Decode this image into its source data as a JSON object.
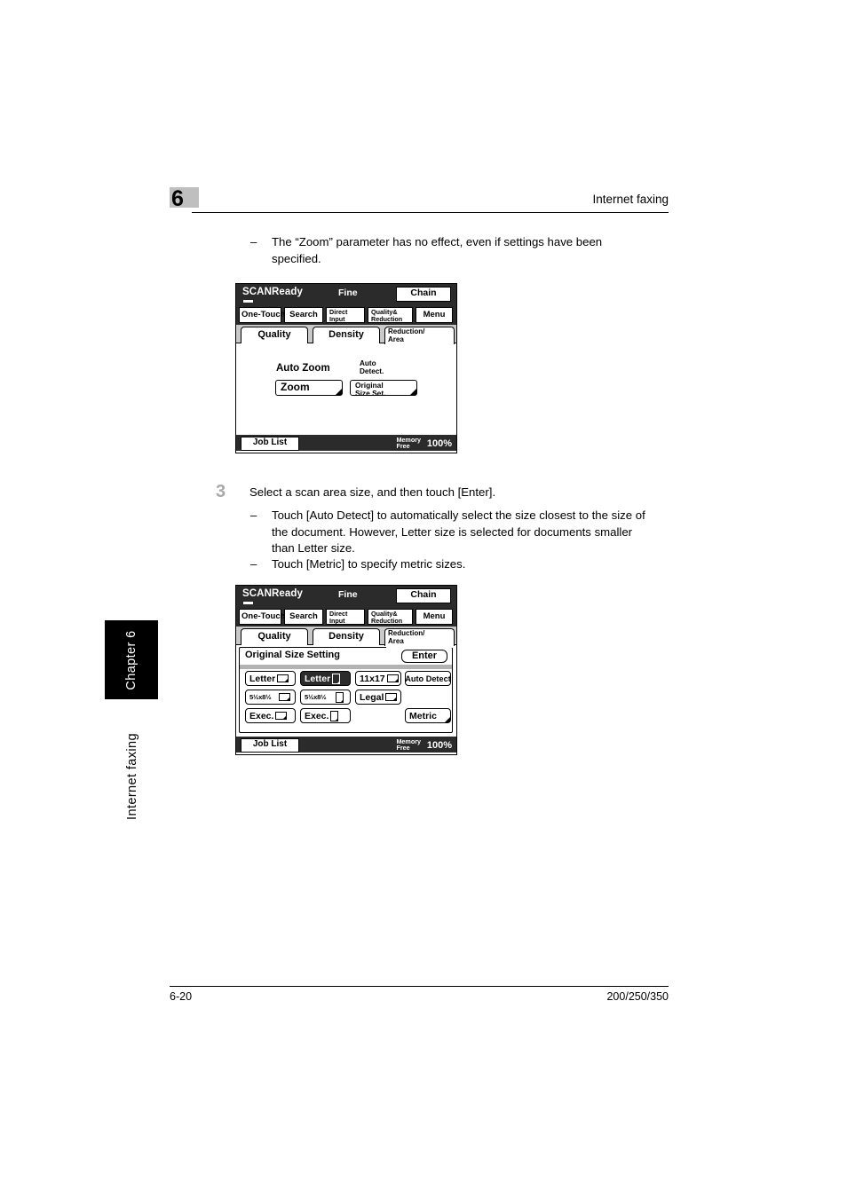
{
  "header": {
    "chapter_number": "6",
    "title": "Internet faxing"
  },
  "sidebar": {
    "chapter_tab": "Chapter 6",
    "running_title": "Internet faxing"
  },
  "footer": {
    "page_number": "6-20",
    "model": "200/250/350"
  },
  "note_1": {
    "dash": "–",
    "text": "The “Zoom” parameter has no effect, even if settings have been specified."
  },
  "step_3": {
    "number": "3",
    "text": "Select a scan area size, and then touch [Enter].",
    "bullets": [
      {
        "dash": "–",
        "text": "Touch [Auto Detect] to automatically select the size closest to the size of the document. However, Letter size is selected for documents smaller than Letter size."
      },
      {
        "dash": "–",
        "text": "Touch [Metric] to specify metric sizes."
      }
    ]
  },
  "lcd_common": {
    "status": "SCANReady",
    "mode": "Fine",
    "chain": "Chain",
    "menu_buttons": [
      {
        "label": "One-Touch",
        "lines": [
          "One-Touch"
        ]
      },
      {
        "label": "Search",
        "lines": [
          "Search"
        ]
      },
      {
        "label": "Direct Input",
        "lines": [
          "Direct",
          "Input"
        ]
      },
      {
        "label": "Quality& Reduction",
        "lines": [
          "Quality&",
          "Reduction"
        ]
      },
      {
        "label": "Menu",
        "lines": [
          "Menu"
        ]
      }
    ],
    "tabs": [
      {
        "label": "Quality",
        "lines": [
          "Quality"
        ],
        "active": false
      },
      {
        "label": "Density",
        "lines": [
          "Density"
        ],
        "active": false
      },
      {
        "label": "Reduction/Area",
        "lines": [
          "Reduction/",
          "Area"
        ],
        "active": true
      }
    ],
    "job_list": "Job List",
    "memory_free_line1": "Memory",
    "memory_free_line2": "Free",
    "memory_percent": "100%"
  },
  "lcd_1": {
    "auto_zoom_label": "Auto Zoom",
    "auto_detect_line1": "Auto",
    "auto_detect_line2": "Detect.",
    "zoom_button": "Zoom",
    "original_size_line1": "Original",
    "original_size_line2": "Size Set."
  },
  "lcd_2": {
    "dialog_title": "Original Size Setting",
    "enter_button": "Enter",
    "size_buttons": [
      {
        "label": "Letter",
        "orientation": "landscape",
        "selected": false,
        "small": false
      },
      {
        "label": "Letter",
        "orientation": "portrait",
        "selected": true,
        "small": false
      },
      {
        "label": "11x17",
        "orientation": "landscape",
        "selected": false,
        "small": false
      },
      {
        "label": "5½x8½",
        "orientation": "landscape",
        "selected": false,
        "small": true
      },
      {
        "label": "5½x8½",
        "orientation": "portrait",
        "selected": false,
        "small": true
      },
      {
        "label": "Legal",
        "orientation": "landscape",
        "selected": false,
        "small": false
      },
      {
        "label": "Exec.",
        "orientation": "landscape",
        "selected": false,
        "small": false
      },
      {
        "label": "Exec.",
        "orientation": "portrait",
        "selected": false,
        "small": false
      }
    ],
    "auto_detect_button": "Auto Detect",
    "metric_button": "Metric"
  },
  "colors": {
    "lcd_dark": "#2b2b2b",
    "tab_strip": "#c9c9c9",
    "chapter_badge": "#bfbfbf",
    "step_number": "#a8a8a8"
  }
}
